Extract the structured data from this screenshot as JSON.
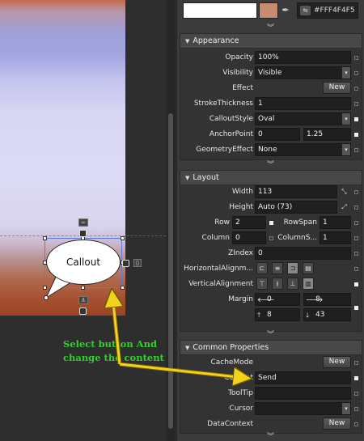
{
  "canvas": {
    "callout_text": "Callout",
    "handle_tag_left": "∞",
    "handle_tag_bottom": "⚓"
  },
  "annotation": {
    "line1": "Select button And",
    "line2": "change the content",
    "color": "#2fd12a"
  },
  "color_picker": {
    "hex_value": "#FFF4F4F5",
    "swatch_primary": "#ffffff",
    "swatch_secondary": "#c98a72"
  },
  "appearance": {
    "header": "Appearance",
    "opacity_label": "Opacity",
    "opacity_value": "100%",
    "visibility_label": "Visibility",
    "visibility_value": "Visible",
    "effect_label": "Effect",
    "effect_button": "New",
    "stroke_label": "StrokeThickness",
    "stroke_value": "1",
    "callout_style_label": "CalloutStyle",
    "callout_style_value": "Oval",
    "anchor_label": "AnchorPoint",
    "anchor_x": "0",
    "anchor_y": "1.25",
    "geometry_label": "GeometryEffect",
    "geometry_value": "None"
  },
  "layout": {
    "header": "Layout",
    "width_label": "Width",
    "width_value": "113",
    "height_label": "Height",
    "height_value": "Auto (73)",
    "row_label": "Row",
    "row_value": "2",
    "rowspan_label": "RowSpan",
    "rowspan_value": "1",
    "column_label": "Column",
    "column_value": "0",
    "columnspan_label": "ColumnS...",
    "columnspan_value": "1",
    "zindex_label": "ZIndex",
    "zindex_value": "0",
    "halign_label": "HorizontalAlignm...",
    "valign_label": "VerticalAlignment",
    "margin_label": "Margin",
    "margin_left": "0",
    "margin_right": "8",
    "margin_top": "8",
    "margin_bottom": "43"
  },
  "common": {
    "header": "Common Properties",
    "cachemode_label": "CacheMode",
    "cachemode_button": "New",
    "content_label": "Content",
    "content_value": "Send",
    "tooltip_label": "ToolTip",
    "tooltip_value": "",
    "cursor_label": "Cursor",
    "cursor_value": "",
    "datacontext_label": "DataContext",
    "datacontext_button": "New"
  }
}
